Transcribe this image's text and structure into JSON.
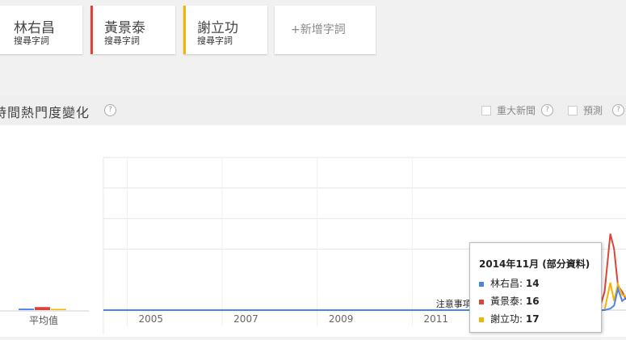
{
  "terms": [
    {
      "name": "林右昌",
      "sub": "搜尋字詞",
      "color": "#4a86e8"
    },
    {
      "name": "黃景泰",
      "sub": "搜尋字詞",
      "color": "#db4437"
    },
    {
      "name": "謝立功",
      "sub": "搜尋字詞",
      "color": "#f4b400"
    }
  ],
  "add_term_label": "+新增字詞",
  "section": {
    "title": "時間熱門度變化",
    "help": "?",
    "options": [
      {
        "label": "重大新聞",
        "help": "?"
      },
      {
        "label": "預測",
        "help": "?"
      }
    ]
  },
  "chart_data": {
    "type": "line",
    "x_ticks": [
      "2005",
      "2007",
      "2009",
      "2011"
    ],
    "average_label": "平均值",
    "note_label": "注意事項",
    "series": [
      {
        "name": "林右昌",
        "color": "#4a86e8",
        "average": 1.0,
        "points": [
          [
            2004.0,
            0
          ],
          [
            2013.0,
            0
          ],
          [
            2014.0,
            0
          ],
          [
            2014.55,
            0
          ],
          [
            2014.67,
            1
          ],
          [
            2014.75,
            3
          ],
          [
            2014.83,
            14
          ],
          [
            2014.92,
            6
          ],
          [
            2015.0,
            8
          ]
        ]
      },
      {
        "name": "黃景泰",
        "color": "#db4437",
        "average": 2.0,
        "points": [
          [
            2004.0,
            0
          ],
          [
            2013.0,
            0
          ],
          [
            2014.0,
            0
          ],
          [
            2014.45,
            2
          ],
          [
            2014.55,
            12
          ],
          [
            2014.67,
            50
          ],
          [
            2014.75,
            40
          ],
          [
            2014.83,
            16
          ],
          [
            2014.92,
            12
          ],
          [
            2015.0,
            7
          ]
        ]
      },
      {
        "name": "謝立功",
        "color": "#f4b400",
        "average": 0.8,
        "points": [
          [
            2004.0,
            0
          ],
          [
            2013.0,
            0
          ],
          [
            2014.0,
            0
          ],
          [
            2014.55,
            0
          ],
          [
            2014.67,
            18
          ],
          [
            2014.75,
            6
          ],
          [
            2014.83,
            17
          ],
          [
            2014.92,
            10
          ],
          [
            2015.0,
            9
          ]
        ]
      }
    ],
    "ylim": [
      0,
      100
    ],
    "xlim": [
      2004.0,
      2015.0
    ],
    "grid": true
  },
  "tooltip": {
    "title": "2014年11月 (部分資料)",
    "rows": [
      {
        "label": "林右昌",
        "value": "14",
        "color": "#4a86e8"
      },
      {
        "label": "黃景泰",
        "value": "16",
        "color": "#db4437"
      },
      {
        "label": "謝立功",
        "value": "17",
        "color": "#f4b400"
      }
    ]
  }
}
